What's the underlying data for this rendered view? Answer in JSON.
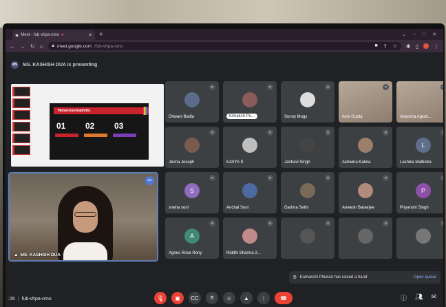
{
  "browser": {
    "tab_title": "Meet - fub-vhpa-omo",
    "url_domain": "meet.google.com",
    "url_path": "/fub-vhpa-omo"
  },
  "presenting_banner": {
    "badge": "MS",
    "text": "MS. KASHISH DUA is presenting"
  },
  "slide": {
    "title": "Heteronormativity",
    "numbers": [
      "01",
      "02",
      "03"
    ]
  },
  "presenter": {
    "name": "MS. KASHISH DUA"
  },
  "participants": [
    {
      "name": "Dhwani Badla",
      "avatar": "",
      "color": "#5b6b8c",
      "kind": "photo"
    },
    {
      "name": "Kimaksh Pu...",
      "avatar": "",
      "color": "#8c5b5b",
      "kind": "photo",
      "pill": true
    },
    {
      "name": "Sunny Mugs",
      "avatar": "",
      "color": "#dddddd",
      "kind": "photo"
    },
    {
      "name": "Avni Gupta",
      "avatar": "",
      "color": "#8e7d6e",
      "kind": "video"
    },
    {
      "name": "Akansha Agrah...",
      "avatar": "",
      "color": "#8e7d6e",
      "kind": "video"
    },
    {
      "name": "Jenna Joseph",
      "avatar": "",
      "color": "#7a5a4a",
      "kind": "photo"
    },
    {
      "name": "KAVYA S",
      "avatar": "",
      "color": "#bfbfbf",
      "kind": "photo"
    },
    {
      "name": "Janhavi Singh",
      "avatar": "",
      "color": "#444444",
      "kind": "photo"
    },
    {
      "name": "Ashwina Kakria",
      "avatar": "",
      "color": "#9c7f6a",
      "kind": "photo"
    },
    {
      "name": "Lashika Malhotra",
      "avatar": "L",
      "color": "#5f6f8a",
      "kind": "letter"
    },
    {
      "name": "sneha soni",
      "avatar": "S",
      "color": "#8e6cc0",
      "kind": "letter"
    },
    {
      "name": "Anchal Soni",
      "avatar": "",
      "color": "#4c6aa0",
      "kind": "photo"
    },
    {
      "name": "Garima Sethi",
      "avatar": "",
      "color": "#7a6a5a",
      "kind": "photo"
    },
    {
      "name": "Anwesh Banerjee",
      "avatar": "",
      "color": "#b08a7a",
      "kind": "photo"
    },
    {
      "name": "Priyanshi Singh",
      "avatar": "P",
      "color": "#8e4fa8",
      "kind": "letter"
    },
    {
      "name": "Agnes Rose Rony",
      "avatar": "A",
      "color": "#3f8a70",
      "kind": "letter"
    },
    {
      "name": "Riddhi Sharma 2...",
      "avatar": "",
      "color": "#c08a8a",
      "kind": "photo"
    },
    {
      "name": "",
      "avatar": "",
      "color": "#555555",
      "kind": "photo"
    },
    {
      "name": "",
      "avatar": "",
      "color": "#666666",
      "kind": "photo"
    },
    {
      "name": "",
      "avatar": "",
      "color": "#777777",
      "kind": "photo"
    }
  ],
  "toast": {
    "text": "Kamakshi Phukan has raised a hand",
    "action": "Open queue"
  },
  "bottom_bar": {
    "time": ":26",
    "meeting_code": "fub-vhpa-omo"
  }
}
